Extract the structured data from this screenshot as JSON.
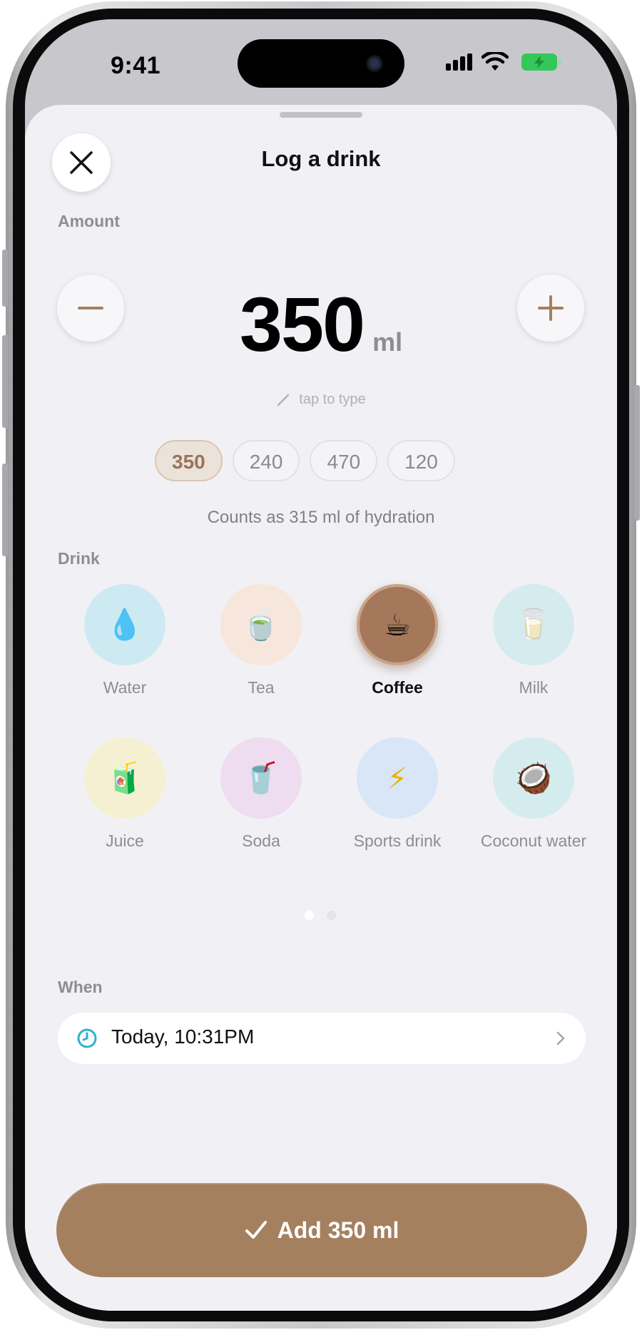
{
  "status_bar": {
    "time": "9:41"
  },
  "sheet": {
    "title": "Log a drink"
  },
  "amount": {
    "section_label": "Amount",
    "value": "350",
    "unit": "ml",
    "tap_hint": "tap to type",
    "presets": [
      "350",
      "240",
      "470",
      "120"
    ],
    "selected_preset": "350",
    "hydration_note": "Counts as 315 ml of hydration"
  },
  "drink": {
    "section_label": "Drink",
    "items": [
      {
        "label": "Water",
        "emoji": "💧",
        "bg": "#cdeaf3"
      },
      {
        "label": "Tea",
        "emoji": "🍵",
        "bg": "#f6e6dc"
      },
      {
        "label": "Coffee",
        "emoji": "☕",
        "bg": "#a5785c"
      },
      {
        "label": "Milk",
        "emoji": "🥛",
        "bg": "#d5ecee"
      },
      {
        "label": "Juice",
        "emoji": "🧃",
        "bg": "#f6f0d2"
      },
      {
        "label": "Soda",
        "emoji": "🥤",
        "bg": "#eedcf0"
      },
      {
        "label": "Sports drink",
        "emoji": "⚡",
        "bg": "#d8e6f7"
      },
      {
        "label": "Coconut water",
        "emoji": "🥥",
        "bg": "#d5ecee"
      }
    ],
    "selected": "Coffee",
    "page_indicator": {
      "pages": 2,
      "current": 1
    }
  },
  "when": {
    "section_label": "When",
    "value": "Today, 10:31PM"
  },
  "add_button": {
    "label": "Add 350 ml"
  },
  "colors": {
    "accent": "#a5805f",
    "accent_light": "#ebe3da",
    "clock_icon": "#2eb0d0",
    "sheet_bg": "#f1f1f5",
    "muted_text": "#8d8d93"
  }
}
